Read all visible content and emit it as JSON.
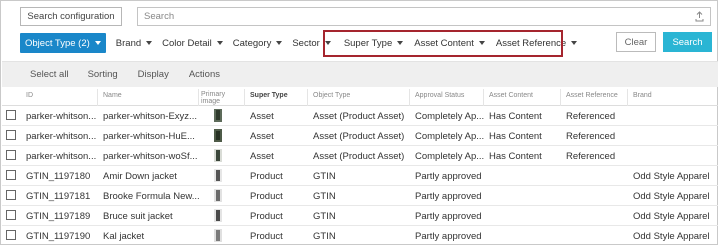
{
  "search": {
    "config_label": "Search configuration",
    "placeholder": "Search"
  },
  "filters": {
    "object_type": "Object Type (2)",
    "brand": "Brand",
    "color_detail": "Color Detail",
    "category": "Category",
    "sector": "Sector",
    "super_type": "Super Type",
    "asset_content": "Asset Content",
    "asset_reference": "Asset Reference",
    "active_color": "#1a87c9",
    "highlight_color": "#a5252e"
  },
  "actions": {
    "clear": "Clear",
    "search": "Search",
    "search_color": "#2ab5d4"
  },
  "toolbar": {
    "select_all": "Select all",
    "sorting": "Sorting",
    "display": "Display",
    "actions": "Actions"
  },
  "table": {
    "columns": {
      "id": "ID",
      "name": "Name",
      "primary_image_1": "Primary",
      "primary_image_2": "image",
      "super_type": "Super Type",
      "object_type": "Object Type",
      "approval_status": "Approval Status",
      "asset_content": "Asset Content",
      "asset_reference": "Asset Reference",
      "brand": "Brand"
    },
    "rows": [
      {
        "id": "parker-whitson...",
        "name": "parker-whitson-Exyz...",
        "super_type": "Asset",
        "object_type": "Asset (Product Asset)",
        "approval_status": "Completely Ap...",
        "asset_content": "Has Content",
        "asset_reference": "Referenced",
        "brand": ""
      },
      {
        "id": "parker-whitson...",
        "name": "parker-whitson-HuE...",
        "super_type": "Asset",
        "object_type": "Asset (Product Asset)",
        "approval_status": "Completely Ap...",
        "asset_content": "Has Content",
        "asset_reference": "Referenced",
        "brand": ""
      },
      {
        "id": "parker-whitson...",
        "name": "parker-whitson-woSf...",
        "super_type": "Asset",
        "object_type": "Asset (Product Asset)",
        "approval_status": "Completely Ap...",
        "asset_content": "Has Content",
        "asset_reference": "Referenced",
        "brand": ""
      },
      {
        "id": "GTIN_1197180",
        "name": "Amir Down jacket",
        "super_type": "Product",
        "object_type": "GTIN",
        "approval_status": "Partly approved",
        "asset_content": "",
        "asset_reference": "",
        "brand": "Odd Style Apparel"
      },
      {
        "id": "GTIN_1197181",
        "name": "Brooke Formula New...",
        "super_type": "Product",
        "object_type": "GTIN",
        "approval_status": "Partly approved",
        "asset_content": "",
        "asset_reference": "",
        "brand": "Odd Style Apparel"
      },
      {
        "id": "GTIN_1197189",
        "name": "Bruce suit jacket",
        "super_type": "Product",
        "object_type": "GTIN",
        "approval_status": "Partly approved",
        "asset_content": "",
        "asset_reference": "",
        "brand": "Odd Style Apparel"
      },
      {
        "id": "GTIN_1197190",
        "name": "Kal jacket",
        "super_type": "Product",
        "object_type": "GTIN",
        "approval_status": "Partly approved",
        "asset_content": "",
        "asset_reference": "",
        "brand": "Odd Style Apparel"
      }
    ]
  }
}
